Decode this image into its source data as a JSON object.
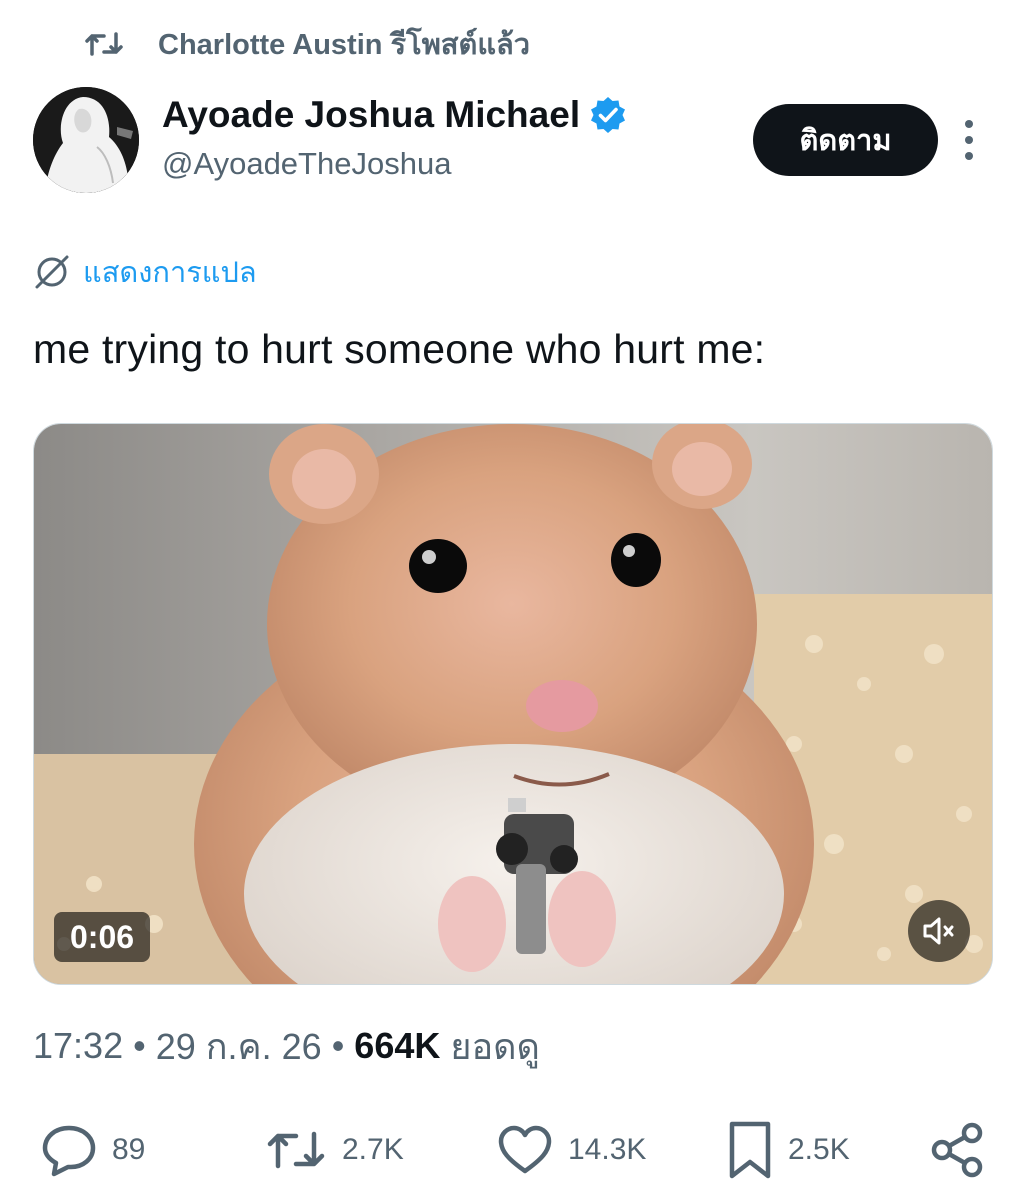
{
  "retweet": {
    "icon": "retweet-icon",
    "text": "Charlotte Austin รีโพสต์แล้ว"
  },
  "author": {
    "name": "Ayoade Joshua Michael",
    "handle": "@AyoadeTheJoshua",
    "verified_icon": "verified-badge-icon",
    "verified_color": "#1d9bf0"
  },
  "follow_button": {
    "label": "ติดตาม"
  },
  "more_icon": "more-vertical-icon",
  "translate": {
    "icon": "globe-icon",
    "label": "แสดงการแปล"
  },
  "tweet": {
    "text": "me trying to hurt someone who hurt me:"
  },
  "media": {
    "duration": "0:06",
    "mute_icon": "speaker-muted-icon"
  },
  "meta": {
    "time": "17:32",
    "date": "29 ก.ค. 26",
    "separator": "•",
    "views_count": "664K",
    "views_label": "ยอดดู"
  },
  "actions": {
    "replies": "89",
    "reposts": "2.7K",
    "likes": "14.3K",
    "bookmarks": "2.5K"
  },
  "colors": {
    "accent": "#1d9bf0",
    "text_primary": "#0f1419",
    "text_secondary": "#536471"
  }
}
